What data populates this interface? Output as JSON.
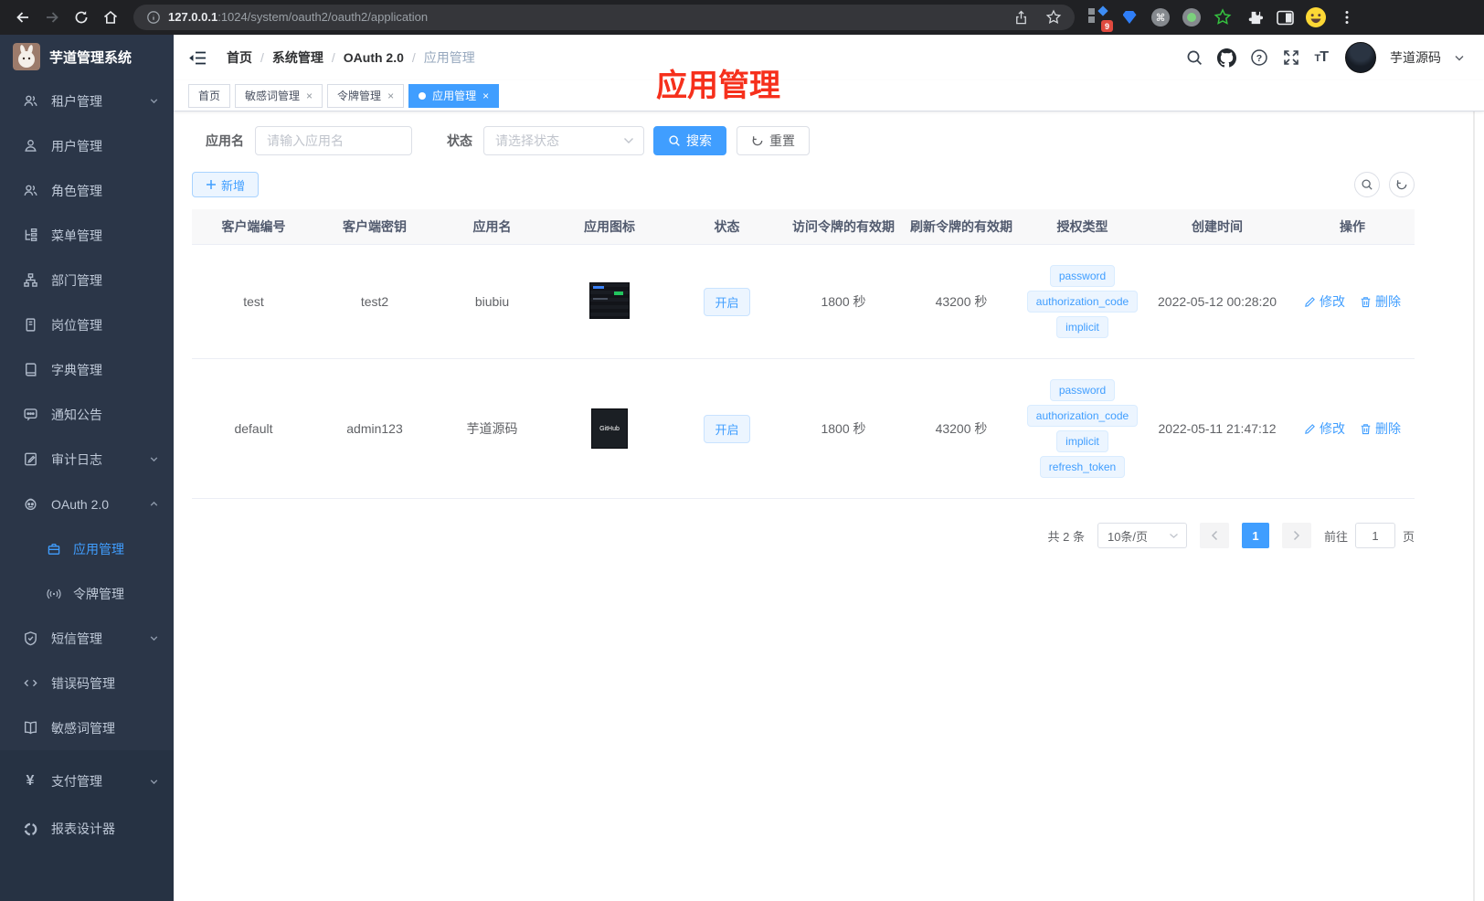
{
  "browser": {
    "url_host": "127.0.0.1",
    "url_path": ":1024/system/oauth2/oauth2/application",
    "extension_badge": "9"
  },
  "colors": {
    "accent": "#409eff",
    "annotation_red": "#f6301c",
    "sidebar_bg": "#2b3648"
  },
  "sidebar": {
    "logo_title": "芋道管理系统",
    "items": [
      {
        "label": "租户管理"
      },
      {
        "label": "用户管理"
      },
      {
        "label": "角色管理"
      },
      {
        "label": "菜单管理"
      },
      {
        "label": "部门管理"
      },
      {
        "label": "岗位管理"
      },
      {
        "label": "字典管理"
      },
      {
        "label": "通知公告"
      },
      {
        "label": "审计日志"
      },
      {
        "label": "OAuth 2.0"
      },
      {
        "label": "应用管理"
      },
      {
        "label": "令牌管理"
      },
      {
        "label": "短信管理"
      },
      {
        "label": "错误码管理"
      },
      {
        "label": "敏感词管理"
      },
      {
        "label": "支付管理"
      },
      {
        "label": "报表设计器"
      }
    ]
  },
  "navbar": {
    "breadcrumb": [
      "首页",
      "系统管理",
      "OAuth 2.0",
      "应用管理"
    ],
    "username": "芋道源码"
  },
  "tabs": {
    "items": [
      {
        "label": "首页"
      },
      {
        "label": "敏感词管理"
      },
      {
        "label": "令牌管理"
      },
      {
        "label": "应用管理"
      }
    ]
  },
  "annotation": {
    "text": "应用管理"
  },
  "filters": {
    "name_label": "应用名",
    "name_placeholder": "请输入应用名",
    "status_label": "状态",
    "status_placeholder": "请选择状态",
    "search_label": "搜索",
    "reset_label": "重置"
  },
  "toolbar": {
    "add_label": "新增"
  },
  "table": {
    "headers": [
      "客户端编号",
      "客户端密钥",
      "应用名",
      "应用图标",
      "状态",
      "访问令牌的有效期",
      "刷新令牌的有效期",
      "授权类型",
      "创建时间",
      "操作"
    ],
    "actions": {
      "edit": "修改",
      "delete": "删除"
    },
    "rows": [
      {
        "client_id": "test",
        "client_secret": "test2",
        "app_name": "biubiu",
        "status": "开启",
        "access_validity": "1800 秒",
        "refresh_validity": "43200 秒",
        "grants": [
          "password",
          "authorization_code",
          "implicit"
        ],
        "created": "2022-05-12 00:28:20"
      },
      {
        "client_id": "default",
        "client_secret": "admin123",
        "app_name": "芋道源码",
        "icon_label": "GitHub",
        "status": "开启",
        "access_validity": "1800 秒",
        "refresh_validity": "43200 秒",
        "grants": [
          "password",
          "authorization_code",
          "implicit",
          "refresh_token"
        ],
        "created": "2022-05-11 21:47:12"
      }
    ]
  },
  "pagination": {
    "total": "共 2 条",
    "page_size": "10条/页",
    "page": "1",
    "goto_label": "前往",
    "goto_value": "1",
    "unit_label": "页"
  }
}
